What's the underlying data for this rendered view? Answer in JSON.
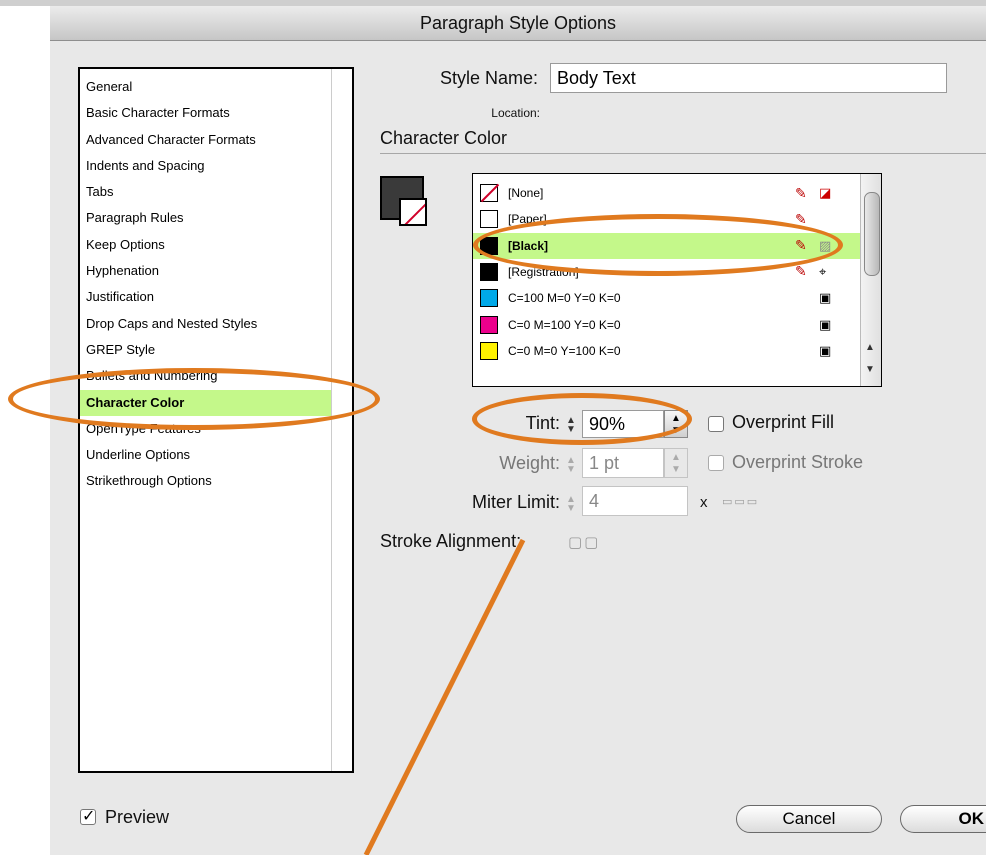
{
  "dialog": {
    "title": "Paragraph Style Options"
  },
  "categories": [
    "General",
    "Basic Character Formats",
    "Advanced Character Formats",
    "Indents and Spacing",
    "Tabs",
    "Paragraph Rules",
    "Keep Options",
    "Hyphenation",
    "Justification",
    "Drop Caps and Nested Styles",
    "GREP Style",
    "Bullets and Numbering",
    "Character Color",
    "OpenType Features",
    "Underline Options",
    "Strikethrough Options"
  ],
  "selected_category": "Character Color",
  "style_name": {
    "label": "Style Name:",
    "value": "Body Text"
  },
  "location_label": "Location:",
  "section_title": "Character Color",
  "swatches": [
    {
      "name": "[None]",
      "color": "#ffffff"
    },
    {
      "name": "[Paper]",
      "color": "#ffffff"
    },
    {
      "name": "[Black]",
      "color": "#000000"
    },
    {
      "name": "[Registration]",
      "color": "#000000"
    },
    {
      "name": "C=100 M=0 Y=0 K=0",
      "color": "#00a9e8"
    },
    {
      "name": "C=0 M=100 Y=0 K=0",
      "color": "#ec008c"
    },
    {
      "name": "C=0 M=0 Y=100 K=0",
      "color": "#fff200"
    }
  ],
  "selected_swatch": "[Black]",
  "tint": {
    "label": "Tint:",
    "value": "90%"
  },
  "weight": {
    "label": "Weight:",
    "value": "1 pt"
  },
  "miter": {
    "label": "Miter Limit:",
    "value": "4",
    "unit": "x"
  },
  "stroke_alignment": {
    "label": "Stroke Alignment:"
  },
  "overprint_fill": {
    "label": "Overprint Fill",
    "checked": false
  },
  "overprint_stroke": {
    "label": "Overprint Stroke",
    "checked": false
  },
  "preview": {
    "label": "Preview",
    "checked": true
  },
  "buttons": {
    "cancel": "Cancel",
    "ok": "OK"
  },
  "annotation_color": "#e07a1f",
  "selection_color": "#c4f88a"
}
